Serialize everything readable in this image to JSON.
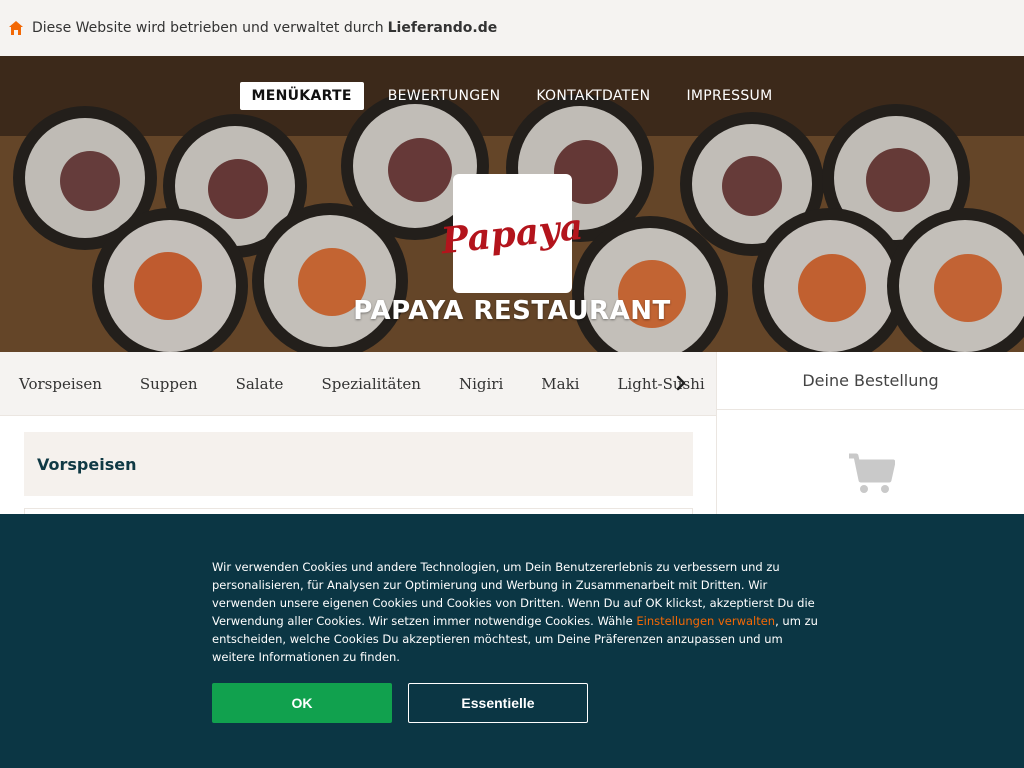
{
  "infobar": {
    "text": "Diese Website wird betrieben und verwaltet durch",
    "brand": "Lieferando.de"
  },
  "nav": {
    "items": [
      "MENÜKARTE",
      "BEWERTUNGEN",
      "KONTAKTDATEN",
      "IMPRESSUM"
    ],
    "active": "MENÜKARTE"
  },
  "restaurant": {
    "logo_text": "Papaya",
    "name": "PAPAYA RESTAURANT"
  },
  "categories": [
    "Vorspeisen",
    "Suppen",
    "Salate",
    "Spezialitäten",
    "Nigiri",
    "Maki",
    "Light-Sushi"
  ],
  "menu": {
    "section_title": "Vorspeisen"
  },
  "order": {
    "title": "Deine Bestellung"
  },
  "cookie": {
    "text_before": "Wir verwenden Cookies und andere Technologien, um Dein Benutzererlebnis zu verbessern und zu personalisieren, für Analysen zur Optimierung und Werbung in Zusammenarbeit mit Dritten. Wir verwenden unsere eigenen Cookies und Cookies von Dritten. Wenn Du auf OK klickst, akzeptierst Du die Verwendung aller Cookies. Wir setzen immer notwendige Cookies. Wähle ",
    "link": "Einstellungen verwalten",
    "text_after": ", um zu entscheiden, welche Cookies Du akzeptieren möchtest, um Deine Präferenzen anzupassen und um weitere Informationen zu finden.",
    "ok_label": "OK",
    "essential_label": "Essentielle"
  },
  "colors": {
    "accent_orange": "#f36805",
    "ok_green": "#11a14e",
    "banner_bg": "#0b3644",
    "logo_red": "#b3141c"
  },
  "icons": {
    "infobar": "home-icon",
    "category_next": "chevron-right-icon",
    "order_empty": "cart-icon"
  }
}
